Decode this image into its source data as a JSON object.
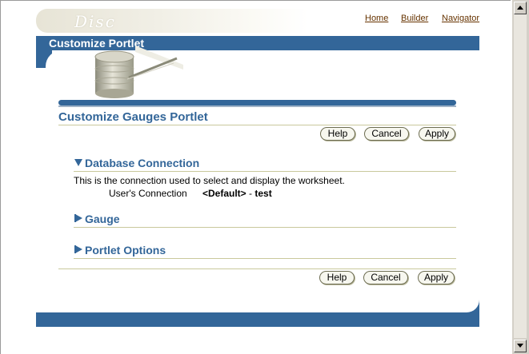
{
  "header": {
    "logo_text": "Disc",
    "links": {
      "home": "Home",
      "builder": "Builder",
      "navigator": "Navigator"
    },
    "title": "Customize Portlet"
  },
  "page": {
    "heading": "Customize Gauges Portlet",
    "buttons": {
      "help": "Help",
      "cancel": "Cancel",
      "apply": "Apply"
    }
  },
  "sections": {
    "database": {
      "title": "Database Connection",
      "expanded": true,
      "description": "This is the connection used to select and display the worksheet.",
      "connection_label": "User's Connection",
      "connection_value": "<Default>",
      "connection_separator": " - ",
      "connection_name": "test"
    },
    "gauge": {
      "title": "Gauge",
      "expanded": false
    },
    "options": {
      "title": "Portlet Options",
      "expanded": false
    }
  },
  "colors": {
    "brand_blue": "#336699",
    "link_brown": "#663300",
    "rule_olive": "#c9c89c"
  }
}
